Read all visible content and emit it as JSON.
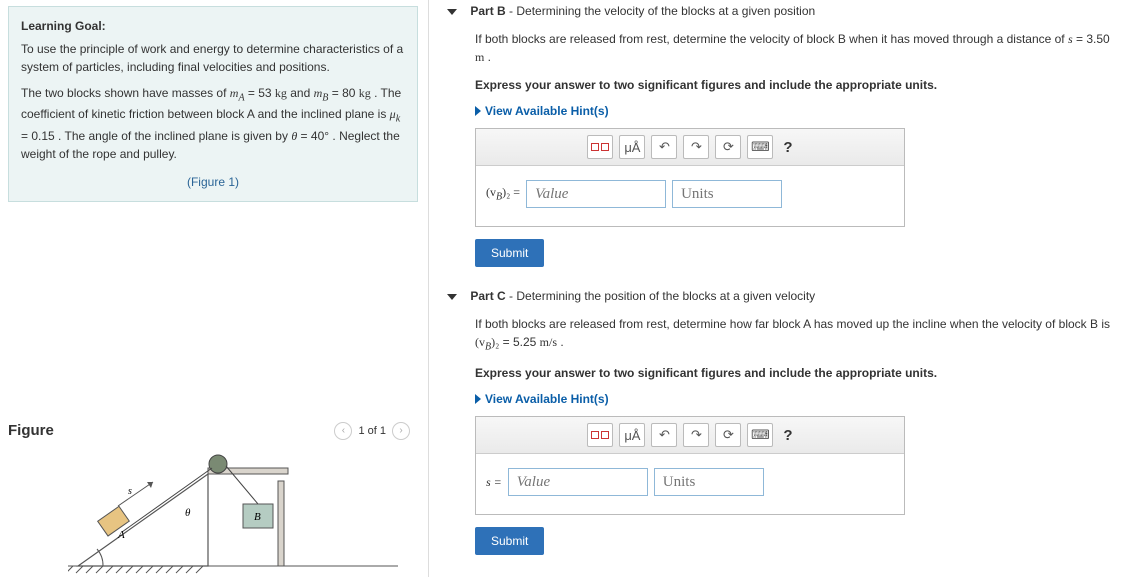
{
  "left": {
    "heading": "Learning Goal:",
    "para1": "To use the principle of work and energy to determine characteristics of a system of particles, including final velocities and positions.",
    "para2_a": "The two blocks shown have masses of ",
    "m_a_sym": "m",
    "m_a_sub": "A",
    "m_a_eq": " = 53 ",
    "m_a_unit": "kg",
    "and_txt": " and ",
    "m_b_sym": "m",
    "m_b_sub": "B",
    "m_b_eq": " = 80 ",
    "m_b_unit": "kg",
    "para2_b": " . The coefficient of kinetic friction between block A and the inclined plane is ",
    "mu_sym": "μ",
    "mu_sub": "k",
    "mu_eq": " = 0.15",
    "para2_c": " . The angle of the inclined plane is given by ",
    "theta_sym": "θ",
    "theta_eq": " = 40",
    "deg_sym": "°",
    "para2_d": " . Neglect the weight of the rope and pulley.",
    "figure_link": "(Figure 1)"
  },
  "figure": {
    "title": "Figure",
    "pager": "1 of 1",
    "label_A": "A",
    "label_B": "B",
    "angle_label": "θ",
    "arrow_label": "s"
  },
  "partB": {
    "part_label": "Part B",
    "part_sub": " - Determining the velocity of the blocks at a given position",
    "line1_a": "If both blocks are released from rest, determine the velocity of block B when it has moved through a distance of ",
    "s_sym": "s",
    "s_eq": " = 3.50 ",
    "s_unit": "m",
    "period": " .",
    "line2": "Express your answer to two significant figures and include the appropriate units.",
    "hints": "View Available Hint(s)",
    "toolbar": {
      "mu_btn": "μÅ",
      "kb_lab": "⌨",
      "help": "?"
    },
    "var_pre": "(v",
    "var_sub": "B",
    "var_post": ")₂ =",
    "value_ph": "Value",
    "units_ph": "Units",
    "submit": "Submit"
  },
  "partC": {
    "part_label": "Part C",
    "part_sub": " - Determining the position of the blocks at a given velocity",
    "line1_a": "If both blocks are released from rest, determine how far block A has moved up the incline when the velocity of block B is ",
    "v_pre": "(v",
    "v_sub": "B",
    "v_post": ")₂",
    "v_eq": " = 5.25 ",
    "v_unit": "m/s",
    "period": " .",
    "line2": "Express your answer to two significant figures and include the appropriate units.",
    "hints": "View Available Hint(s)",
    "toolbar": {
      "mu_btn": "μÅ",
      "kb_lab": "⌨",
      "help": "?"
    },
    "var_label": "s =",
    "value_ph": "Value",
    "units_ph": "Units",
    "submit": "Submit"
  }
}
